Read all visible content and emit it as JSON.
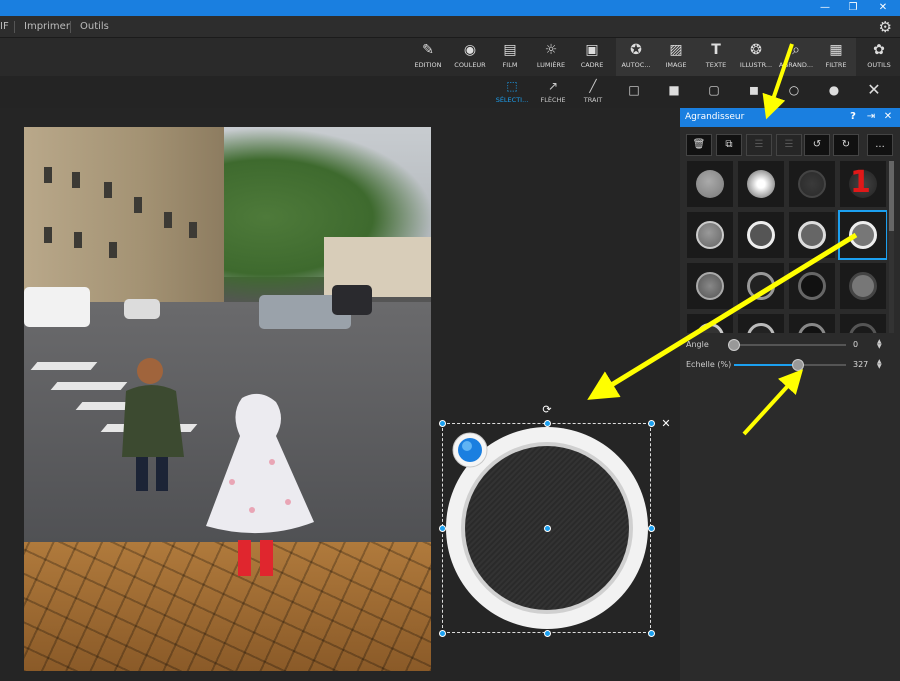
{
  "menu": {
    "items": [
      "IF",
      "Imprimer",
      "Outils"
    ]
  },
  "toolbar": {
    "tools": [
      {
        "label": "EDITION",
        "icon": "edit-icon"
      },
      {
        "label": "COULEUR",
        "icon": "color-icon"
      },
      {
        "label": "FILM",
        "icon": "film-icon"
      },
      {
        "label": "LUMIÈRE",
        "icon": "light-icon"
      },
      {
        "label": "CADRE",
        "icon": "frame-icon"
      },
      {
        "label": "AUTOC...",
        "icon": "sticker-icon"
      },
      {
        "label": "IMAGE",
        "icon": "image-icon"
      },
      {
        "label": "TEXTE",
        "icon": "text-icon"
      },
      {
        "label": "ILLUSTR...",
        "icon": "illustration-icon"
      },
      {
        "label": "AGRAND...",
        "icon": "magnifier-icon"
      },
      {
        "label": "FILTRE",
        "icon": "filter-icon"
      },
      {
        "label": "OUTILS",
        "icon": "palette-icon"
      }
    ]
  },
  "subtoolbar": {
    "tools": [
      {
        "label": "SÉLECTI...",
        "icon": "selection-icon",
        "active": true
      },
      {
        "label": "FLÈCHE",
        "icon": "arrow-icon"
      },
      {
        "label": "TRAIT",
        "icon": "line-icon"
      }
    ]
  },
  "panel": {
    "title": "Agrandisseur",
    "more_label": "...",
    "angle": {
      "label": "Angle",
      "value": "0",
      "fraction": 0.0
    },
    "scale": {
      "label": "Echelle (%)",
      "value": "327",
      "fraction": 0.57
    }
  },
  "annotations": {
    "number": "1"
  },
  "colors": {
    "accent": "#1ca0f0",
    "titlebar": "#1a7fe0",
    "arrow": "#ffff00",
    "marker": "#e01818"
  }
}
